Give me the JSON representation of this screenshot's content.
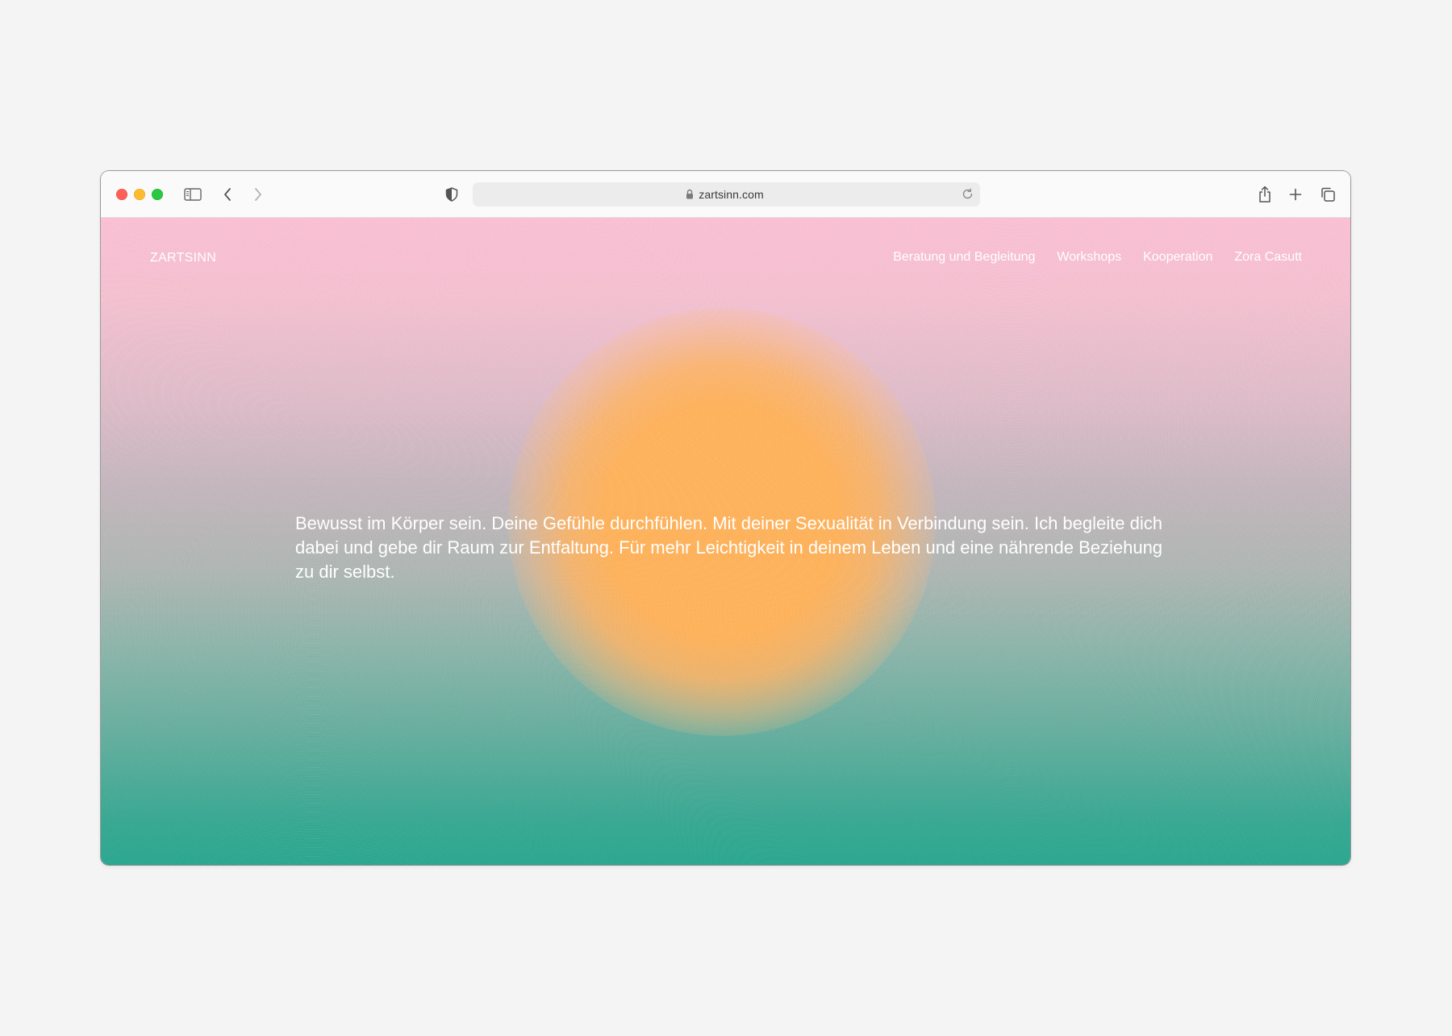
{
  "browser": {
    "url": "zartsinn.com"
  },
  "site": {
    "logo": "ZARTSINN",
    "nav": [
      {
        "label": "Beratung und Begleitung"
      },
      {
        "label": "Workshops"
      },
      {
        "label": "Kooperation"
      },
      {
        "label": "Zora Casutt"
      }
    ],
    "intro": "Bewusst im Körper sein. Deine Gefühle durchfühlen. Mit deiner Sexualität in Verbindung sein. Ich begleite dich dabei und gebe dir Raum zur Entfaltung. Für mehr Leichtigkeit in deinem Leben und eine nährende Beziehung zu dir selbst."
  },
  "icons": {
    "toolbar_left": [
      "close-window-icon",
      "minimize-window-icon",
      "zoom-window-icon",
      "sidebar-icon",
      "back-chevron-icon",
      "forward-chevron-icon",
      "privacy-shield-icon"
    ],
    "address": [
      "lock-icon",
      "reload-icon"
    ],
    "toolbar_right": [
      "share-icon",
      "new-tab-plus-icon",
      "tab-overview-icon"
    ]
  },
  "colors": {
    "page_background": "#f4f4f4",
    "gradient_top": "#fbc0d4",
    "gradient_bottom": "#2aa78f",
    "sun": "#ffb25a",
    "text": "#ffffff",
    "traffic_red": "#fe5f57",
    "traffic_yellow": "#febc2e",
    "traffic_green": "#28c840"
  }
}
